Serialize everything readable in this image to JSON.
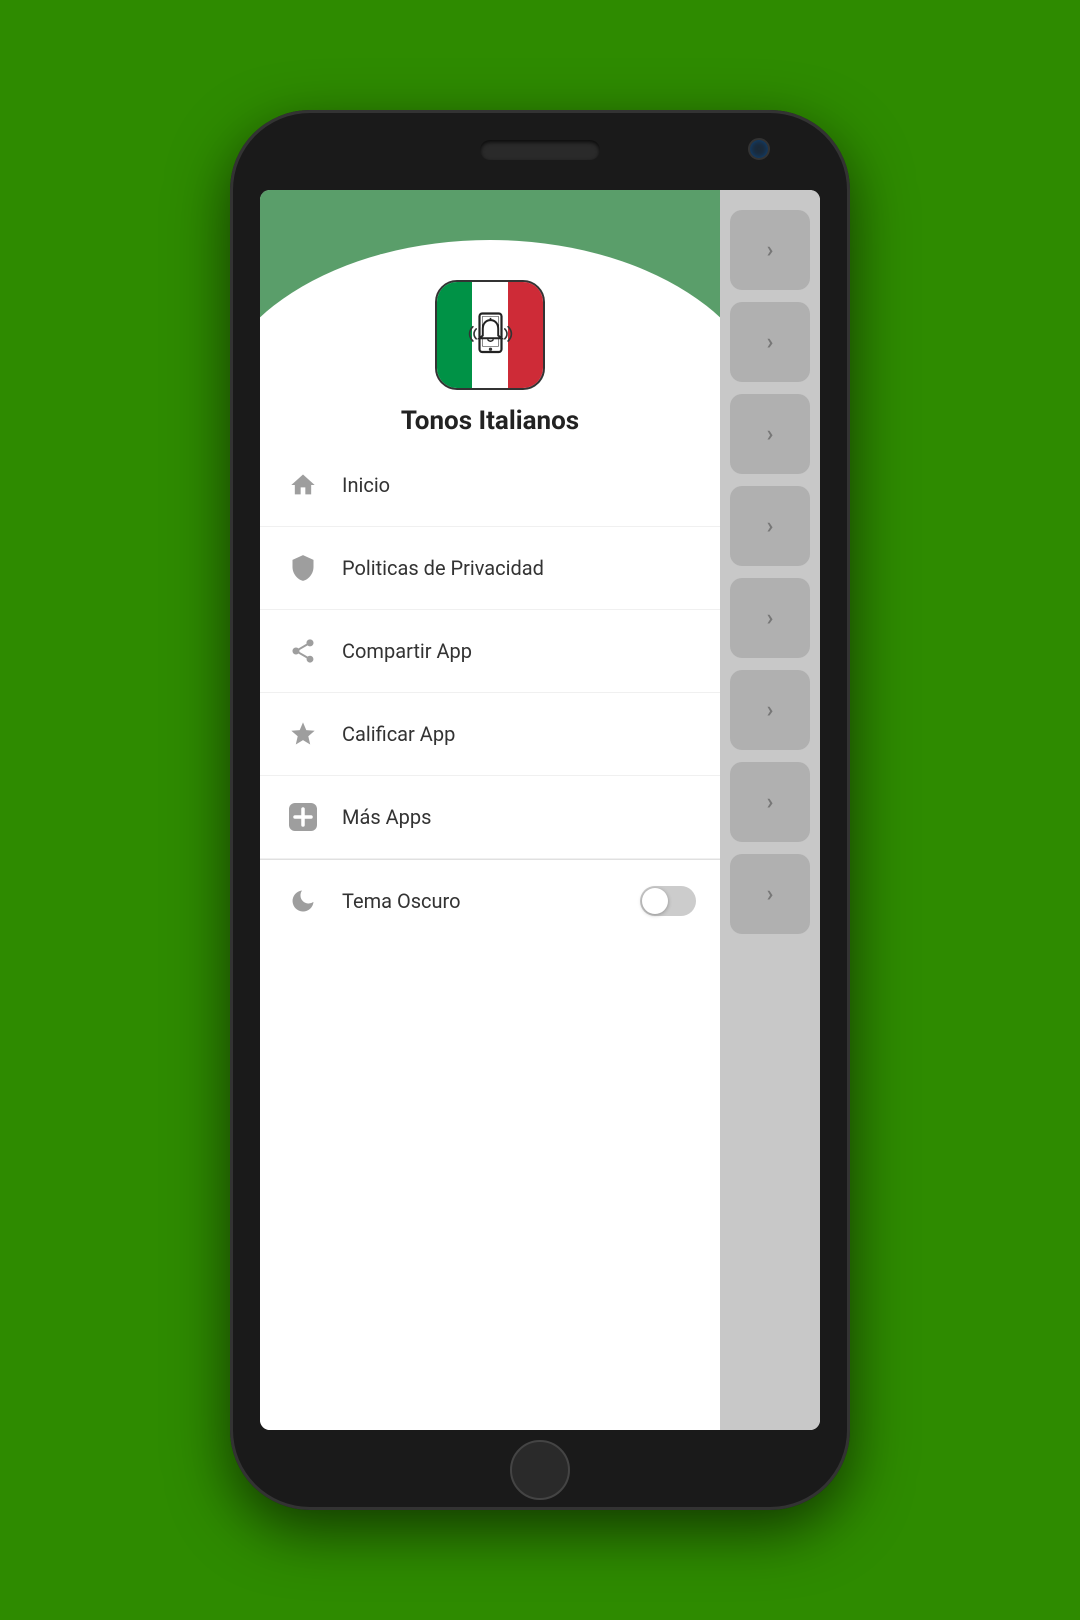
{
  "background": {
    "color": "#2e8b00"
  },
  "app": {
    "title": "Tonos Italianos",
    "logo_alt": "Tonos Italianos App Icon"
  },
  "menu": {
    "items": [
      {
        "id": "inicio",
        "label": "Inicio",
        "icon": "home"
      },
      {
        "id": "privacidad",
        "label": "Politicas de Privacidad",
        "icon": "shield"
      },
      {
        "id": "compartir",
        "label": "Compartir App",
        "icon": "share"
      },
      {
        "id": "calificar",
        "label": "Calificar App",
        "icon": "star"
      },
      {
        "id": "mas-apps",
        "label": "Más Apps",
        "icon": "plus"
      }
    ],
    "toggle": {
      "label": "Tema Oscuro",
      "icon": "moon",
      "enabled": false
    }
  },
  "right_panel": {
    "arrows": [
      "›",
      "›",
      "›",
      "›",
      "›",
      "›",
      "›",
      "›"
    ]
  }
}
